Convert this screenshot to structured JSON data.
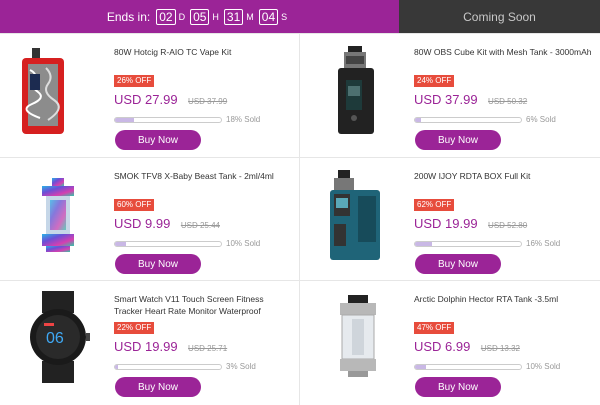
{
  "countdown": {
    "label": "Ends in:",
    "days": "02",
    "days_unit": "D",
    "hours": "05",
    "hours_unit": "H",
    "minutes": "31",
    "minutes_unit": "M",
    "seconds": "04",
    "seconds_unit": "S"
  },
  "coming_soon": "Coming Soon",
  "buy_label": "Buy Now",
  "colors": {
    "accent": "#9b2497",
    "badge": "#e74c3c",
    "header_inactive": "#383838"
  },
  "products": [
    {
      "title": "80W Hotcig R-AIO TC Vape Kit",
      "discount": "26% OFF",
      "price": "USD 27.99",
      "old_price": "USD 37.99",
      "sold": "18% Sold",
      "sold_fraction": 0.18,
      "icon": "vape-mod-red-icon"
    },
    {
      "title": "80W OBS Cube Kit with Mesh Tank - 3000mAh",
      "discount": "24% OFF",
      "price": "USD 37.99",
      "old_price": "USD 50.32",
      "sold": "6% Sold",
      "sold_fraction": 0.06,
      "icon": "vape-cube-black-icon"
    },
    {
      "title": "SMOK TFV8 X-Baby Beast Tank - 2ml/4ml",
      "discount": "60% OFF",
      "price": "USD 9.99",
      "old_price": "USD 25.44",
      "sold": "10% Sold",
      "sold_fraction": 0.1,
      "icon": "tank-rainbow-icon"
    },
    {
      "title": "200W IJOY RDTA BOX Full Kit",
      "discount": "62% OFF",
      "price": "USD 19.99",
      "old_price": "USD 52.80",
      "sold": "16% Sold",
      "sold_fraction": 0.16,
      "icon": "box-mod-teal-icon"
    },
    {
      "title": "Smart Watch V11 Touch Screen Fitness Tracker Heart Rate Monitor Waterproof",
      "discount": "22% OFF",
      "price": "USD 19.99",
      "old_price": "USD 25.71",
      "sold": "3% Sold",
      "sold_fraction": 0.03,
      "icon": "smartwatch-icon"
    },
    {
      "title": "Arctic Dolphin Hector RTA Tank -3.5ml",
      "discount": "47% OFF",
      "price": "USD 6.99",
      "old_price": "USD 13.32",
      "sold": "10% Sold",
      "sold_fraction": 0.1,
      "icon": "rta-tank-silver-icon"
    }
  ]
}
